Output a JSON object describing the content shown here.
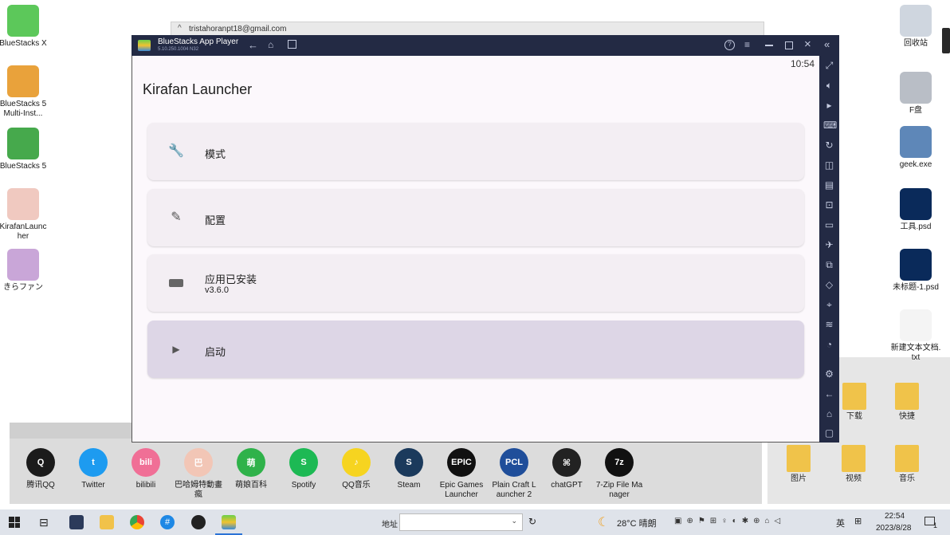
{
  "desktop_left": [
    {
      "label": "BlueStacks X",
      "color": "#5cc85a"
    },
    {
      "label": "BlueStacks 5 Multi-Inst...",
      "color": "#e9a23b"
    },
    {
      "label": "BlueStacks 5",
      "color": "#46a94c"
    },
    {
      "label": "KirafanLauncher",
      "color": "#f0c9c0"
    },
    {
      "label": "きらファン",
      "color": "#c9a6d8"
    }
  ],
  "desktop_right": [
    {
      "label": "回收站",
      "color": "#cfd6df"
    },
    {
      "label": "F盘",
      "color": "#b9bec6"
    },
    {
      "label": "geek.exe",
      "color": "#5e87b8"
    },
    {
      "label": "工具.psd",
      "color": "#0a2a5a"
    },
    {
      "label": "未标题-1.psd",
      "color": "#0a2a5a"
    },
    {
      "label": "新建文本文档.txt",
      "color": "#f4f4f4"
    }
  ],
  "background_window": {
    "email": "tristahoranpt18@gmail.com"
  },
  "bluestacks": {
    "title": "BlueStacks App Player",
    "version": "5.10.250.1004 N32",
    "time": "10:54",
    "app_title": "Kirafan Launcher",
    "cards": [
      {
        "title": "模式",
        "subtitle": "",
        "icon": "wrench-icon"
      },
      {
        "title": "配置",
        "subtitle": "",
        "icon": "pencil-icon"
      },
      {
        "title": "应用已安装",
        "subtitle": "v3.6.0",
        "icon": "gamepad-icon"
      },
      {
        "title": "启动",
        "subtitle": "",
        "icon": "play-icon"
      }
    ],
    "accent": "#ddd6e6"
  },
  "shelf_apps": [
    {
      "label": "腾讯QQ",
      "color": "#1b1b1b",
      "glyph": "Q"
    },
    {
      "label": "Twitter",
      "color": "#1d9bf0",
      "glyph": "t"
    },
    {
      "label": "bilibili",
      "color": "#f06f96",
      "glyph": "bili"
    },
    {
      "label": "巴哈姆特動畫瘋",
      "color": "#f2c6b6",
      "glyph": "巴"
    },
    {
      "label": "萌娘百科",
      "color": "#2fb24a",
      "glyph": "萌"
    },
    {
      "label": "Spotify",
      "color": "#1db954",
      "glyph": "S"
    },
    {
      "label": "QQ音乐",
      "color": "#f6d420",
      "glyph": "♪"
    },
    {
      "label": "Steam",
      "color": "#1b3a5c",
      "glyph": "S"
    },
    {
      "label": "Epic Games Launcher",
      "color": "#111111",
      "glyph": "EPIC"
    },
    {
      "label": "Plain Craft Launcher 2",
      "color": "#1f4e9a",
      "glyph": "PCL"
    },
    {
      "label": "chatGPT",
      "color": "#222222",
      "glyph": "⌘"
    },
    {
      "label": "7-Zip File Manager",
      "color": "#111111",
      "glyph": "7z"
    }
  ],
  "explorer_items": [
    {
      "label": "下载",
      "color": "#f0c34a"
    },
    {
      "label": "快捷",
      "color": "#f0c34a"
    },
    {
      "label": "图片",
      "color": "#f0c34a"
    },
    {
      "label": "视频",
      "color": "#f0c34a"
    },
    {
      "label": "音乐",
      "color": "#f0c34a"
    }
  ],
  "taskbar": {
    "address_label": "地址",
    "weather": "28°C 晴朗",
    "ime": "英",
    "time": "22:54",
    "date": "2023/8/28",
    "notification_count": "1"
  }
}
